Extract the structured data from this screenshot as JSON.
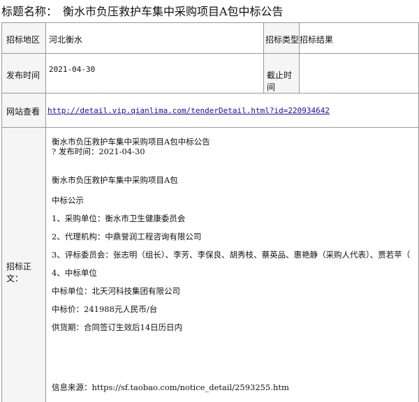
{
  "title": {
    "label": "标题名称：",
    "text": "衡水市负压救护车集中采购项目A包中标公告"
  },
  "rows": {
    "region_label": "招标地区",
    "region_value": "河北衡水",
    "type_label": "招标类型",
    "type_value": "招标结果",
    "publish_label": "发布时间",
    "publish_value": "2021-04-30",
    "deadline_label": "截止时间",
    "deadline_value": "",
    "url_label": "网站查看",
    "url_value": "http://detail.vip.qianlima.com/tenderDetail.html?id=220934642",
    "body_label": "招标正文："
  },
  "body": {
    "line1": "衡水市负压救护车集中采购项目A包中标公告",
    "line2": "? 发布时间：2021-04-30",
    "line3": "衡水市负压救护车集中采购项目A包",
    "line4": "中标公示",
    "line5": "1、采购单位：衡水市卫生健康委员会",
    "line6": "2、代理机构：中鼎誉润工程咨询有限公司",
    "line7": "3、评标委员会：张志明（组长）、李芳、李保良、胡秀枝、蔡英品、惠艳静（采购人代表）、贾若苹（",
    "line8": "4、中标单位",
    "line9": "中标单位：北天河科技集团有限公司",
    "line10": "中标价：241988元人民币/台",
    "line11": "供货期：合同签订生效后14日历日内",
    "line12": "信息来源：https://sf.taobao.com/notice_detail/2593255.htm"
  }
}
